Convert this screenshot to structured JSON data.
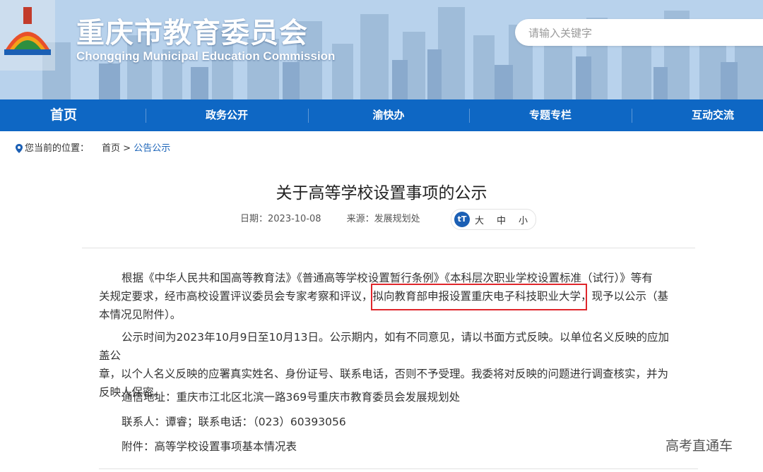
{
  "header": {
    "title": "重庆市教育委员会",
    "subtitle": "Chongqing Municipal Education Commission",
    "search_placeholder": "请输入关键字"
  },
  "nav": {
    "items": [
      {
        "label": "首页"
      },
      {
        "label": "政务公开"
      },
      {
        "label": "渝快办"
      },
      {
        "label": "专题专栏"
      },
      {
        "label": "互动交流"
      }
    ]
  },
  "breadcrumb": {
    "prefix": "您当前的位置：",
    "home": "首页",
    "sep": ">",
    "current": "公告公示"
  },
  "article": {
    "title": "关于高等学校设置事项的公示",
    "date": "日期：2023-10-08",
    "source": "来源：发展规划处",
    "font_icon": "tT",
    "font_sizes": [
      "大",
      "中",
      "小"
    ],
    "para1_line1": "根据《中华人民共和国高等教育法》《普通高等学校设置暂行条例》《本科层次职业学校设置标准（试行）》等有",
    "para1_line2": "关规定要求，经市高校设置评议委员会专家考察和评议，拟向教育部申报设置重庆电子科技职业大学，现予以公示（基",
    "para1_line3": "本情况见附件）。",
    "para2_line1": "公示时间为2023年10月9日至10月13日。公示期内，如有不同意见，请以书面方式反映。以单位名义反映的应加盖公",
    "para2_line2": "章，以个人名义反映的应署真实姓名、身份证号、联系电话，否则不予受理。我委将对反映的问题进行调查核实，并为",
    "para2_line3": "反映人保密。",
    "address": "通信地址：重庆市江北区北滨一路369号重庆市教育委员会发展规划处",
    "contact": "联系人：谭睿；联系电话：（023）60393056",
    "attachment": "附件：高等学校设置事项基本情况表"
  },
  "watermark": "高考直通车",
  "colors": {
    "nav_bg": "#0e67c4",
    "highlight_border": "#e0262b",
    "link": "#1a63b8"
  }
}
